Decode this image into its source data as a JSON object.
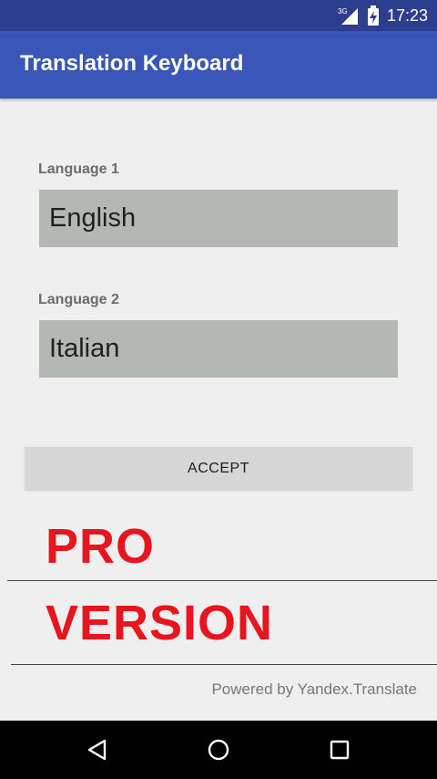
{
  "status_bar": {
    "network": "3G",
    "time": "17:23"
  },
  "app_bar": {
    "title": "Translation Keyboard"
  },
  "form": {
    "language1_label": "Language 1",
    "language1_value": "English",
    "language2_label": "Language 2",
    "language2_value": "Italian",
    "accept_label": "ACCEPT"
  },
  "promo": {
    "line1": "PRO",
    "line2": "VERSION",
    "color": "#e8141e"
  },
  "footer": {
    "powered_by": "Powered by Yandex.Translate"
  },
  "nav": {
    "back_icon": "back-triangle-icon",
    "home_icon": "home-circle-icon",
    "recents_icon": "recents-square-icon"
  }
}
